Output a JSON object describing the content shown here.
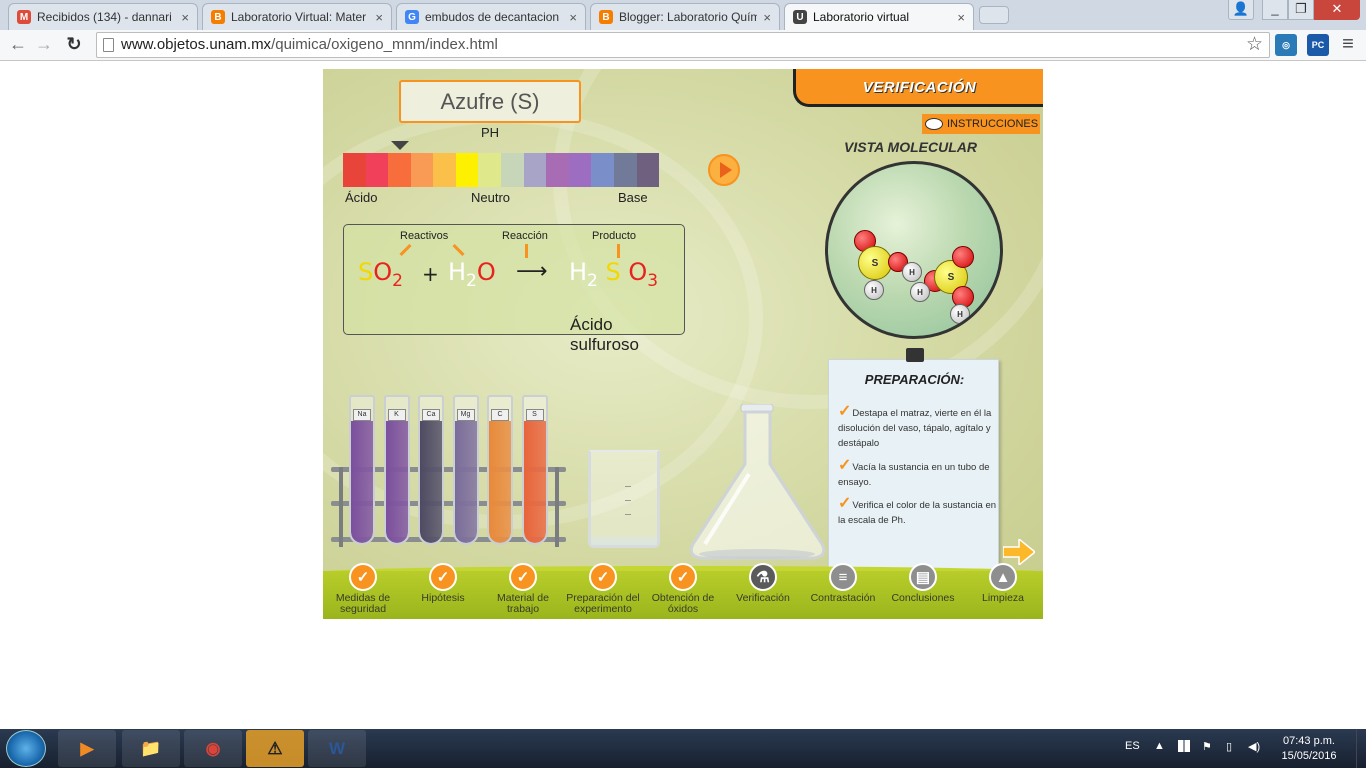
{
  "browser": {
    "tabs": [
      {
        "title": "Recibidos (134) - dannari",
        "icon": "gmail-icon",
        "color": "#dd4b39",
        "glyph": "M"
      },
      {
        "title": "Laboratorio Virtual: Mater",
        "icon": "blogger-icon",
        "color": "#f57d00",
        "glyph": "B"
      },
      {
        "title": "embudos de decantacion",
        "icon": "google-icon",
        "color": "#4285f4",
        "glyph": "G"
      },
      {
        "title": "Blogger: Laboratorio Quím",
        "icon": "blogger-icon",
        "color": "#f57d00",
        "glyph": "B"
      },
      {
        "title": "Laboratorio virtual",
        "icon": "unam-icon",
        "color": "#444444",
        "glyph": "U"
      }
    ],
    "tab_close": "×",
    "window_buttons": {
      "minimize": "_",
      "maximize": "❐",
      "close": "✕",
      "profile": "👤"
    },
    "nav": {
      "back": "←",
      "forward": "→",
      "reload": "↻"
    },
    "url_host": "www.objetos.unam.mx",
    "url_path": "/quimica/oxigeno_mnm/index.html",
    "bookmark": "☆",
    "extensions": [
      {
        "label": "◎",
        "color": "#2a7ab8"
      },
      {
        "label": "PC",
        "color": "#1a5aa8"
      }
    ],
    "menu": "≡"
  },
  "app": {
    "element_title": "Azufre (S)",
    "ph_label": "PH",
    "ph_colors": [
      "#e8443a",
      "#f0405a",
      "#f76d3c",
      "#f99a55",
      "#fbc04a",
      "#fdf000",
      "#dfe88a",
      "#c7d6b8",
      "#a8a4c8",
      "#a86cb4",
      "#9c6dc0",
      "#7a8fc9",
      "#727a9a",
      "#6f6080"
    ],
    "ph_acid": "Ácido",
    "ph_neutral": "Neutro",
    "ph_base": "Base",
    "equation": {
      "label_reactants": "Reactivos",
      "label_reaction": "Reacción",
      "label_product": "Producto",
      "r1_s": "S",
      "r1_o": "O",
      "r1_sub": "2",
      "plus": "+",
      "r2_h": "H",
      "r2_sub": "2",
      "r2_o": "O",
      "arrow": "⟶",
      "p_h": "H",
      "p_sub1": "2",
      "p_s": "S",
      "p_o": "O",
      "p_sub2": "3",
      "product_name": "Ácido sulfuroso"
    },
    "verification_header": "VERIFICACIÓN",
    "instructions": "INSTRUCCIONES",
    "molecular_view": "VISTA MOLECULAR",
    "atoms": {
      "sulfur": "S",
      "hydrogen": "H"
    },
    "preparation": {
      "title": "PREPARACIÓN:",
      "steps": [
        "Destapa el matraz, vierte en él la disolución del vaso, tápalo, agítalo y destápalo",
        "Vacía la sustancia en un tubo de ensayo.",
        "Verifica el color de la sustancia en la escala de Ph."
      ],
      "check": "✓"
    },
    "tubes": [
      {
        "label": "Na",
        "color": "#7b4f9d"
      },
      {
        "label": "K",
        "color": "#7b4f9d"
      },
      {
        "label": "Ca",
        "color": "#4e4a63"
      },
      {
        "label": "Mg",
        "color": "#7a6c9a"
      },
      {
        "label": "C",
        "color": "#e8893a"
      },
      {
        "label": "S",
        "color": "#e8643a"
      }
    ],
    "nav_steps": [
      {
        "label": "Medidas de seguridad",
        "state": "done",
        "glyph": "✓"
      },
      {
        "label": "Hipótesis",
        "state": "done",
        "glyph": "✓"
      },
      {
        "label": "Material de trabajo",
        "state": "done",
        "glyph": "✓"
      },
      {
        "label": "Preparación del experimento",
        "state": "done",
        "glyph": "✓"
      },
      {
        "label": "Obtención de óxidos",
        "state": "done",
        "glyph": "✓"
      },
      {
        "label": "Verificación",
        "state": "current",
        "glyph": "⚗"
      },
      {
        "label": "Contrastación",
        "state": "locked",
        "glyph": "≡"
      },
      {
        "label": "Conclusiones",
        "state": "locked",
        "glyph": "▤"
      },
      {
        "label": "Limpieza",
        "state": "locked",
        "glyph": "▲"
      }
    ]
  },
  "taskbar": {
    "apps": [
      {
        "name": "media-player",
        "glyph": "▶",
        "color": "#f08a24"
      },
      {
        "name": "file-explorer",
        "glyph": "📁",
        "color": "#e8c35a"
      },
      {
        "name": "chrome",
        "glyph": "◉",
        "color": "#db4437"
      },
      {
        "name": "warning-app",
        "glyph": "⚠",
        "color": "#f2c200"
      },
      {
        "name": "word",
        "glyph": "W",
        "color": "#2b5797"
      }
    ],
    "language": "ES",
    "time": "07:43 p.m.",
    "date": "15/05/2016"
  }
}
